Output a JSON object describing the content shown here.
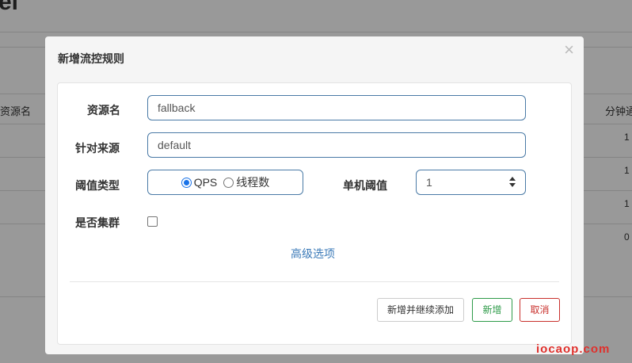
{
  "background": {
    "title_fragment": "el",
    "table": {
      "left_header": "资源名",
      "right_header": "分钟通",
      "right_column_values": [
        "1",
        "1",
        "1",
        "0"
      ]
    }
  },
  "modal": {
    "title": "新增流控规则",
    "close_symbol": "×",
    "fields": {
      "resource": {
        "label": "资源名",
        "value": "fallback"
      },
      "limit_app": {
        "label": "针对来源",
        "value": "default"
      },
      "threshold_type": {
        "label": "阈值类型",
        "options": [
          {
            "label": "QPS",
            "checked": true
          },
          {
            "label": "线程数",
            "checked": false
          }
        ]
      },
      "single_threshold": {
        "label": "单机阈值",
        "value": "1"
      },
      "cluster": {
        "label": "是否集群",
        "checked": false
      }
    },
    "advanced_link": "高级选项",
    "buttons": {
      "add_continue": "新增并继续添加",
      "add": "新增",
      "cancel": "取消"
    }
  },
  "watermark": "iocaop.com",
  "colors": {
    "input_border": "#4a7aa6",
    "link": "#3b7ab8",
    "success": "#2e9b49",
    "danger": "#c9302c",
    "watermark": "#e0302c"
  }
}
